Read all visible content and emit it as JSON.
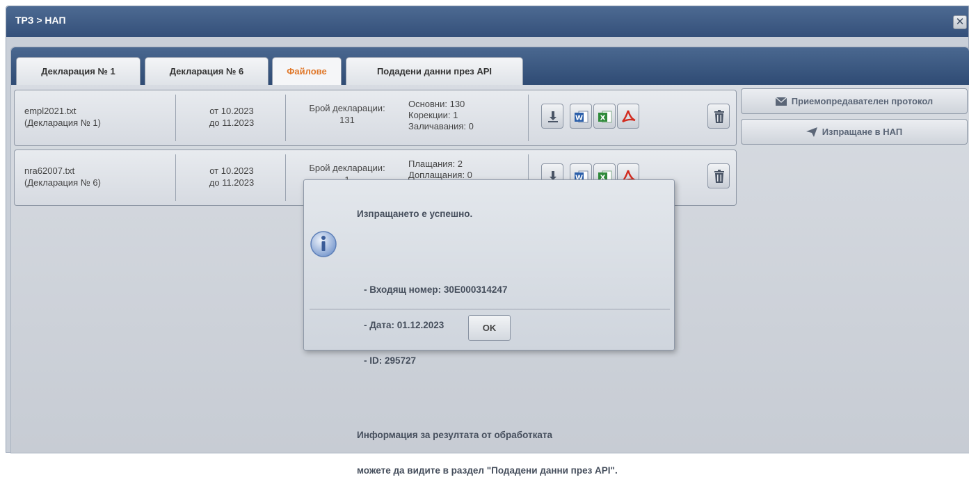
{
  "window": {
    "title": "ТРЗ > НАП"
  },
  "tabs": [
    {
      "label": "Декларация № 1",
      "active": false
    },
    {
      "label": "Декларация № 6",
      "active": false
    },
    {
      "label": "Файлове",
      "active": true
    },
    {
      "label": "Подадени данни през API",
      "active": false
    }
  ],
  "files": [
    {
      "name": "empl2021.txt",
      "declaration": "(Декларация № 1)",
      "period_from": "от 10.2023",
      "period_to": "до 11.2023",
      "count_label": "Брой декларации:",
      "count_value": "131",
      "stats": [
        "Основни: 130",
        "Корекции: 1",
        "Заличавания: 0"
      ]
    },
    {
      "name": "nra62007.txt",
      "declaration": "(Декларация № 6)",
      "period_from": "от 10.2023",
      "period_to": "до 11.2023",
      "count_label": "Брой декларации:",
      "count_value": "1",
      "stats": [
        "Плащания: 2",
        "Доплащания: 0"
      ]
    }
  ],
  "side_buttons": {
    "protocol": "Приемопредавателен протокол",
    "send": "Изпращане в НАП"
  },
  "dialog": {
    "heading": "Изпращането е успешно.",
    "incoming": "- Входящ номер: 30Е000314247",
    "date": "- Дата: 01.12.2023",
    "id": "- ID: 295727",
    "info_line1": "Информация за резултата от обработката",
    "info_line2": "можете да видите в раздел \"Подадени данни през API\".",
    "ok": "OK"
  },
  "icons": {
    "download": "download-icon",
    "word": "word-icon",
    "excel": "excel-icon",
    "pdf": "pdf-icon",
    "trash": "trash-icon",
    "envelope": "envelope-icon",
    "send": "paper-plane-icon",
    "info": "info-icon",
    "close": "close-icon"
  },
  "colors": {
    "titlebar": "#3c5882",
    "active_tab_text": "#e0782a",
    "word_blue": "#2b5faa",
    "excel_green": "#2f8a3a",
    "pdf_red": "#d22a1e"
  }
}
